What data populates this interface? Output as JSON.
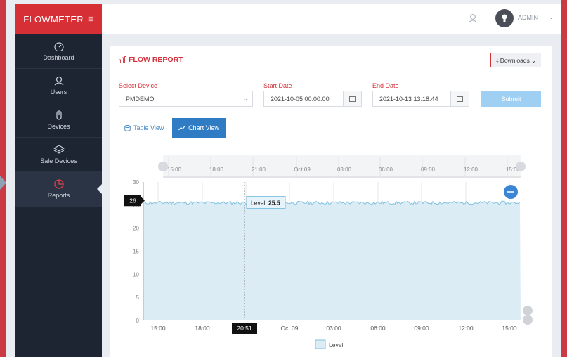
{
  "app": {
    "brand": "FLOWMETER",
    "admin_label": "ADMIN"
  },
  "sidebar": {
    "items": [
      {
        "label": "Dashboard",
        "icon": "speedometer-icon"
      },
      {
        "label": "Users",
        "icon": "user-icon"
      },
      {
        "label": "Devices",
        "icon": "device-icon"
      },
      {
        "label": "Sale Devices",
        "icon": "layers-icon"
      },
      {
        "label": "Reports",
        "icon": "pie-chart-icon",
        "active": true
      }
    ]
  },
  "report": {
    "title": "FLOW REPORT",
    "downloads_label": "Downloads",
    "device_label": "Select Device",
    "device_value": "PMDEMO",
    "start_label": "Start Date",
    "start_value": "2021-10-05 00:00:00",
    "end_label": "End Date",
    "end_value": "2021-10-13 13:18:44",
    "submit_label": "Submit",
    "tab_table": "Table View",
    "tab_chart": "Chart View"
  },
  "colors": {
    "accent_red": "#d72f36",
    "sidebar_bg": "#1d2532",
    "chart_blue": "#2f7bc4",
    "series_stroke": "#7fc1e0",
    "series_fill": "#dcecf5",
    "submit_bg": "#9fd0f3"
  },
  "chart_data": {
    "type": "area",
    "series": [
      {
        "name": "Level",
        "level_min": 25.0,
        "level_max": 26.0,
        "level_typical": 25.5
      }
    ],
    "ylim": [
      0,
      30
    ],
    "yticks": [
      "0",
      "5",
      "10",
      "15",
      "20",
      "25",
      "30"
    ],
    "xticks": [
      "15:00",
      "18:00",
      "20:51",
      "Oct 09",
      "03:00",
      "06:00",
      "09:00",
      "12:00",
      "15:00"
    ],
    "navigator_ticks": [
      "15:00",
      "18:00",
      "21:00",
      "Oct 09",
      "03:00",
      "06:00",
      "09:00",
      "12:00",
      "15:00"
    ],
    "crosshair": {
      "y_label": "26",
      "x_label": "20:51"
    },
    "tooltip": {
      "label": "Level:",
      "value": "25.5"
    },
    "legend": [
      "Level"
    ],
    "legend_position": "bottom"
  }
}
